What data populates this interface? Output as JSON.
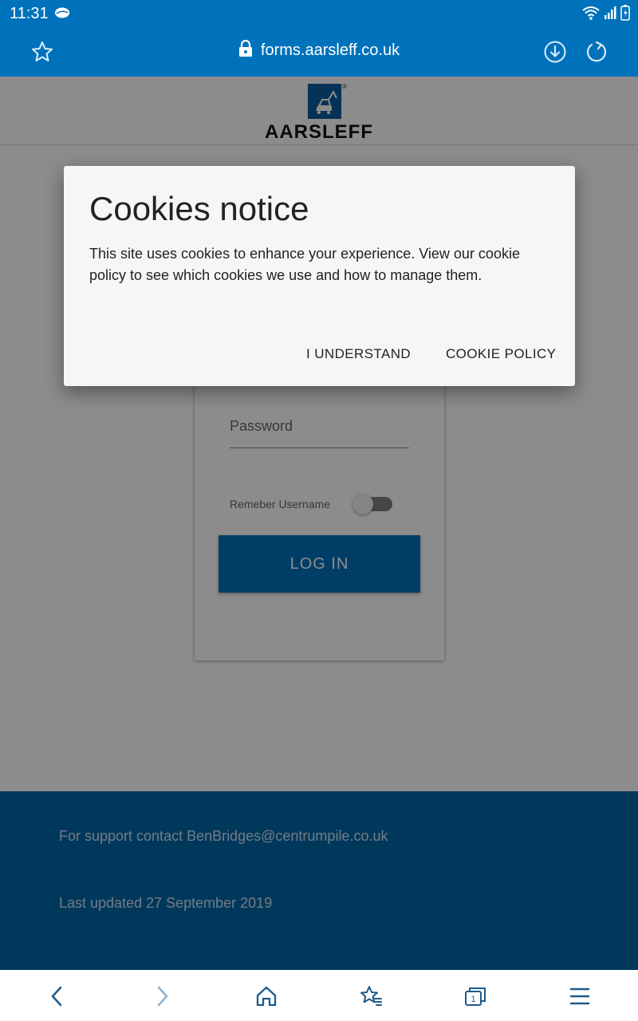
{
  "status_bar": {
    "time": "11:31"
  },
  "browser": {
    "url": "forms.aarsleff.co.uk"
  },
  "site": {
    "logo_text": "AARSLEFF",
    "logo_reg": "®"
  },
  "login": {
    "password_placeholder": "Password",
    "remember_label": "Remeber Username",
    "login_button": "LOG IN"
  },
  "footer": {
    "support": "For support contact BenBridges@centrumpile.co.uk",
    "updated": "Last updated 27 September 2019"
  },
  "dialog": {
    "title": "Cookies notice",
    "text": "This site uses cookies to enhance your experience. View our cookie policy to see which cookies we use and how to manage them.",
    "understand_button": "I UNDERSTAND",
    "policy_button": "COOKIE POLICY"
  },
  "icons": {
    "status": [
      "cloud-icon",
      "wifi-icon",
      "signal-icon",
      "battery-icon"
    ],
    "toolbar": [
      "star-icon",
      "lock-icon",
      "download-icon",
      "reload-icon"
    ],
    "bottom_nav": [
      "back-icon",
      "forward-icon",
      "home-icon",
      "bookmarks-icon",
      "tabs-icon",
      "menu-icon"
    ]
  },
  "colors": {
    "brand_blue": "#0072bc",
    "footer_blue": "#0066a8",
    "logo_blue": "#0b5c9e",
    "dialog_bg": "#f6f6f7"
  }
}
